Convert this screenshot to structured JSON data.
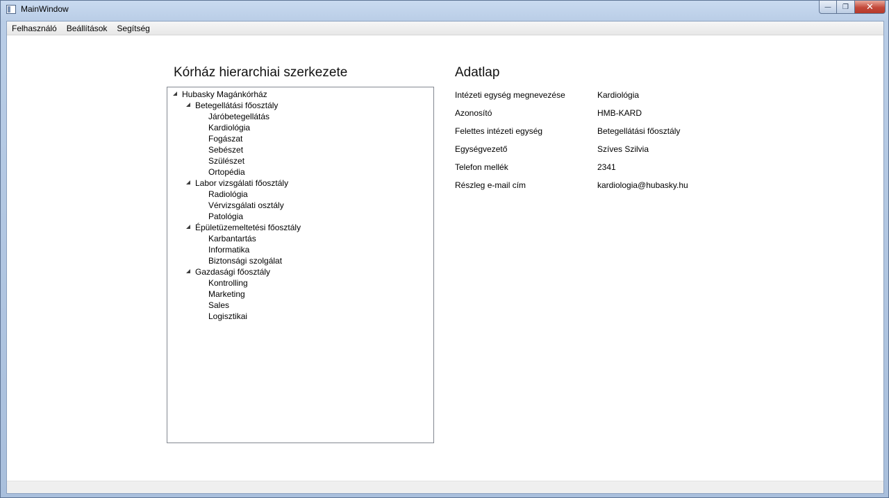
{
  "window": {
    "title": "MainWindow",
    "minimize_glyph": "—",
    "maximize_glyph": "❐",
    "close_glyph": "✕"
  },
  "menu": {
    "items": [
      "Felhasználó",
      "Beállítások",
      "Segítség"
    ]
  },
  "tree_panel": {
    "title": "Kórház hierarchiai szerkezete",
    "root": {
      "label": "Hubasky Magánkórház",
      "expanded": true,
      "children": [
        {
          "label": "Betegellátási főosztály",
          "expanded": true,
          "children": [
            "Járóbetegellátás",
            "Kardiológia",
            "Fogászat",
            "Sebészet",
            "Szülészet",
            "Ortopédia"
          ]
        },
        {
          "label": "Labor vizsgálati főosztály",
          "expanded": true,
          "children": [
            "Radiológia",
            "Vérvizsgálati osztály",
            "Patológia"
          ]
        },
        {
          "label": "Épületüzemeltetési főosztály",
          "expanded": true,
          "children": [
            "Karbantartás",
            "Informatika",
            "Biztonsági szolgálat"
          ]
        },
        {
          "label": "Gazdasági főosztály",
          "expanded": true,
          "children": [
            "Kontrolling",
            "Marketing",
            "Sales",
            "Logisztikai"
          ]
        }
      ]
    }
  },
  "detail_panel": {
    "title": "Adatlap",
    "fields": [
      {
        "label": "Intézeti egység megnevezése",
        "value": "Kardiológia"
      },
      {
        "label": "Azonosító",
        "value": "HMB-KARD"
      },
      {
        "label": "Felettes intézeti egység",
        "value": "Betegellátási főosztály"
      },
      {
        "label": "Egységvezető",
        "value": "Szíves Szilvia"
      },
      {
        "label": "Telefon mellék",
        "value": "2341"
      },
      {
        "label": "Részleg e-mail cím",
        "value": "kardiologia@hubasky.hu"
      }
    ]
  }
}
